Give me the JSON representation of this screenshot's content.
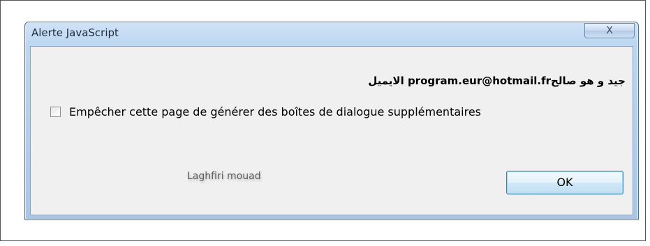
{
  "dialog": {
    "title": "Alerte JavaScript",
    "close_label": "X",
    "message": "جيد و هو صالحprogram.eur@hotmail.fr الايميل",
    "checkbox_label": "Empêcher cette page de générer des boîtes de dialogue supplémentaires",
    "checkbox_checked": false,
    "ok_label": "OK",
    "watermark": "Laghfiri mouad"
  }
}
